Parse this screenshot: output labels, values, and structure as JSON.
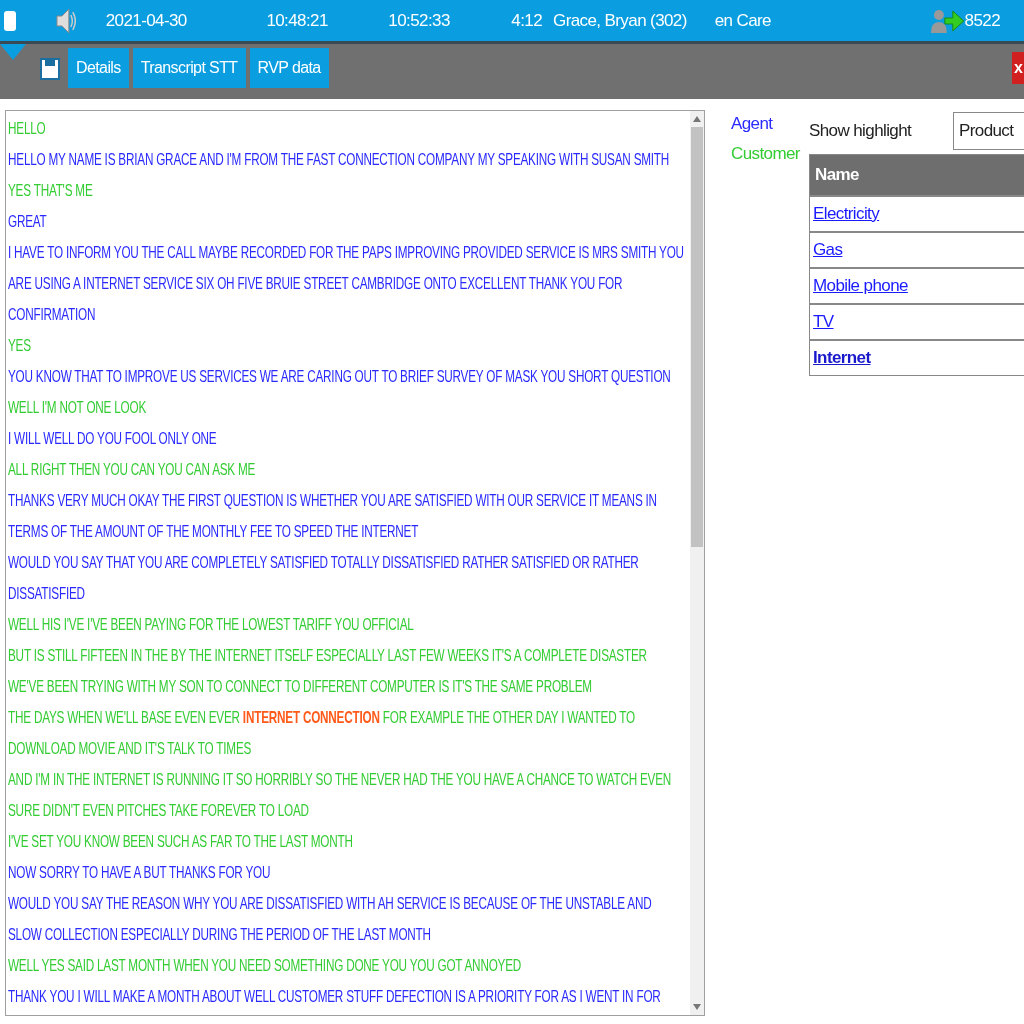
{
  "call_bar": {
    "checked": false,
    "date": "2021-04-30",
    "start_time": "10:48:21",
    "end_time": "10:52:33",
    "duration": "4:12",
    "agent": "Grace, Bryan (302)",
    "queue": "en Care",
    "number": "8522"
  },
  "tabs": [
    {
      "label": "Details"
    },
    {
      "label": "Transcript STT"
    },
    {
      "label": "RVP data"
    }
  ],
  "close_label": "x",
  "transcript": [
    {
      "kind": "customer",
      "text": "HELLO"
    },
    {
      "kind": "agent",
      "text": "HELLO MY NAME IS BRIAN GRACE AND I'M FROM THE FAST CONNECTION COMPANY MY SPEAKING WITH SUSAN SMITH"
    },
    {
      "kind": "customer",
      "text": "YES THAT'S ME"
    },
    {
      "kind": "agent",
      "text": "GREAT"
    },
    {
      "kind": "agent",
      "text": "I HAVE TO INFORM YOU THE CALL MAYBE RECORDED FOR THE PAPS IMPROVING PROVIDED SERVICE IS MRS SMITH YOU ARE USING A INTERNET SERVICE SIX OH FIVE BRUIE STREET CAMBRIDGE ONTO EXCELLENT THANK YOU FOR CONFIRMATION"
    },
    {
      "kind": "customer",
      "text": "YES"
    },
    {
      "kind": "agent",
      "text": "YOU KNOW THAT TO IMPROVE US SERVICES WE ARE CARING OUT TO BRIEF SURVEY OF MASK YOU SHORT QUESTION"
    },
    {
      "kind": "customer",
      "text": "WELL I'M NOT ONE LOOK"
    },
    {
      "kind": "agent",
      "text": "I WILL WELL DO YOU FOOL ONLY ONE"
    },
    {
      "kind": "customer",
      "text": "ALL RIGHT THEN YOU CAN YOU CAN ASK ME"
    },
    {
      "kind": "agent",
      "text": "THANKS VERY MUCH OKAY THE FIRST QUESTION IS WHETHER YOU ARE SATISFIED WITH OUR SERVICE IT MEANS IN TERMS OF THE AMOUNT OF THE MONTHLY FEE TO SPEED THE INTERNET"
    },
    {
      "kind": "agent",
      "text": "WOULD YOU SAY THAT YOU ARE COMPLETELY SATISFIED TOTALLY DISSATISFIED RATHER SATISFIED OR RATHER DISSATISFIED"
    },
    {
      "kind": "customer",
      "text": "WELL HIS I'VE I'VE BEEN PAYING FOR THE LOWEST TARIFF YOU OFFICIAL"
    },
    {
      "kind": "customer",
      "text": "BUT IS STILL FIFTEEN IN THE BY THE INTERNET ITSELF ESPECIALLY LAST FEW WEEKS IT'S A COMPLETE DISASTER"
    },
    {
      "kind": "customer",
      "text": "WE'VE BEEN TRYING WITH MY SON TO CONNECT TO DIFFERENT COMPUTER IS IT'S THE SAME PROBLEM"
    },
    {
      "kind": "customer",
      "text": "THE DAYS WHEN WE'LL BASE EVEN EVER **INTERNET CONNECTION** FOR EXAMPLE THE OTHER DAY I WANTED TO DOWNLOAD MOVIE AND IT'S TALK TO TIMES"
    },
    {
      "kind": "customer",
      "text": "AND I'M IN THE INTERNET IS RUNNING IT SO HORRIBLY SO THE NEVER HAD THE YOU HAVE A CHANCE TO WATCH EVEN SURE DIDN'T EVEN PITCHES TAKE FOREVER TO LOAD"
    },
    {
      "kind": "customer",
      "text": "I'VE SET YOU KNOW BEEN SUCH AS FAR TO THE LAST MONTH"
    },
    {
      "kind": "agent",
      "text": "NOW SORRY TO HAVE A BUT THANKS FOR YOU"
    },
    {
      "kind": "agent",
      "text": "WOULD YOU SAY THE REASON WHY YOU ARE DISSATISFIED WITH AH SERVICE IS BECAUSE OF THE UNSTABLE AND SLOW COLLECTION ESPECIALLY DURING THE PERIOD OF THE LAST MONTH"
    },
    {
      "kind": "customer",
      "text": "WELL YES SAID LAST MONTH WHEN YOU NEED SOMETHING DONE YOU YOU GOT ANNOYED"
    },
    {
      "kind": "agent",
      "text": "THANK YOU I WILL MAKE A MONTH ABOUT WELL CUSTOMER STUFF DEFECTION IS A PRIORITY FOR AS I WENT IN FOR"
    }
  ],
  "legend": [
    {
      "kind": "agent",
      "label": "Agent"
    },
    {
      "kind": "customer",
      "label": "Customer"
    }
  ],
  "highlight": {
    "label": "Show highlight",
    "value": "Product"
  },
  "table": {
    "columns": [
      "Name"
    ],
    "rows": [
      {
        "name": "Electricity",
        "highlighted": false
      },
      {
        "name": "Gas",
        "highlighted": false
      },
      {
        "name": "Mobile phone",
        "highlighted": false
      },
      {
        "name": "TV",
        "highlighted": false
      },
      {
        "name": "Internet",
        "highlighted": true
      }
    ]
  }
}
